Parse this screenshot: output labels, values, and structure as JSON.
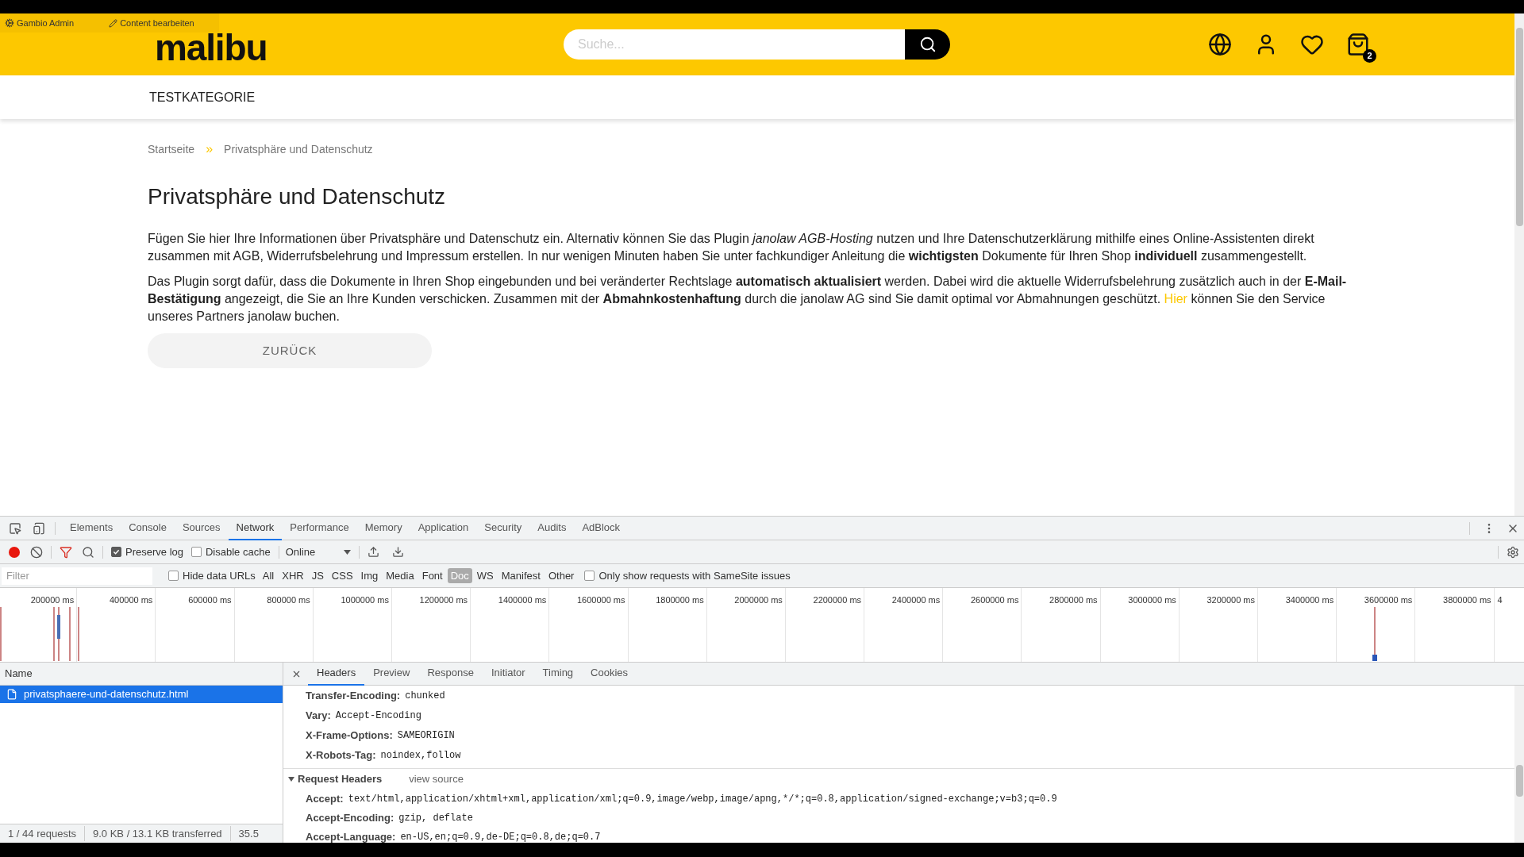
{
  "admin_bar": {
    "items": [
      "Gambio Admin",
      "Content bearbeiten"
    ]
  },
  "header": {
    "logo": "malibu",
    "search": {
      "placeholder": "Suche..."
    },
    "cart_count": "2"
  },
  "nav": {
    "items": [
      "TESTKATEGORIE"
    ]
  },
  "breadcrumb": {
    "items": [
      "Startseite",
      "Privatsphäre und Datenschutz"
    ],
    "separator": "»"
  },
  "content": {
    "title": "Privatsphäre und Datenschutz",
    "paragraph_1": "Fügen Sie hier Ihre Informationen über Privatsphäre und Datenschutz ein. Alternativ können Sie das Plugin *janolaw AGB-Hosting* nutzen und Ihre Datenschutzerklärung mithilfe eines Online-Assistenten direkt zusammen mit AGB, Widerrufsbelehrung und Impressum erstellen. In nur wenigen Minuten haben Sie unter fachkundiger Anleitung die **wichtigsten** Dokumente für Ihren Shop **individuell** zusammengestellt.",
    "paragraph_2": {
      "before": "Das Plugin sorgt dafür, dass die Dokumente in Ihren Shop eingebunden und bei veränderter Rechtslage **automatisch aktualisiert** werden. Dabei wird die aktuelle Widerrufsbelehrung zusätzlich auch in der **E-Mail-Bestätigung** angezeigt, die Sie an Ihre Kunden verschicken. Zusammen mit der **Abmahnkostenhaftung** durch die janolaw AG sind Sie damit optimal vor Abmahnungen geschützt.",
      "link": "Hier",
      "after": "können Sie den Service unseres Partners janolaw buchen."
    },
    "back_button": "ZURÜCK"
  },
  "devtools": {
    "tabs": [
      {
        "label": "Elements",
        "selected": false
      },
      {
        "label": "Console",
        "selected": false
      },
      {
        "label": "Sources",
        "selected": false
      },
      {
        "label": "Network",
        "selected": true
      },
      {
        "label": "Performance",
        "selected": false
      },
      {
        "label": "Memory",
        "selected": false
      },
      {
        "label": "Application",
        "selected": false
      },
      {
        "label": "Security",
        "selected": false
      },
      {
        "label": "Audits",
        "selected": false
      },
      {
        "label": "AdBlock",
        "selected": false
      }
    ],
    "toolbar": {
      "recording": true,
      "preserve_log": {
        "label": "Preserve log",
        "checked": true
      },
      "disable_cache": {
        "label": "Disable cache",
        "checked": false
      },
      "throttling": "Online"
    },
    "filter": {
      "placeholder": "Filter",
      "hide_data_urls": {
        "label": "Hide data URLs",
        "checked": false
      },
      "types": [
        {
          "label": "All",
          "selected": false
        },
        {
          "label": "XHR",
          "selected": false
        },
        {
          "label": "JS",
          "selected": false
        },
        {
          "label": "CSS",
          "selected": false
        },
        {
          "label": "Img",
          "selected": false
        },
        {
          "label": "Media",
          "selected": false
        },
        {
          "label": "Font",
          "selected": false
        },
        {
          "label": "Doc",
          "selected": true
        },
        {
          "label": "WS",
          "selected": false
        },
        {
          "label": "Manifest",
          "selected": false
        },
        {
          "label": "Other",
          "selected": false
        }
      ],
      "samesite": {
        "label": "Only show requests with SameSite issues",
        "checked": false
      }
    },
    "timeline": {
      "ticks": [
        "200000 ms",
        "400000 ms",
        "600000 ms",
        "800000 ms",
        "1000000 ms",
        "1200000 ms",
        "1400000 ms",
        "1600000 ms",
        "1800000 ms",
        "2000000 ms",
        "2200000 ms",
        "2400000 ms",
        "2600000 ms",
        "2800000 ms",
        "3000000 ms",
        "3200000 ms",
        "3400000 ms",
        "3600000 ms",
        "3800000 ms",
        "4"
      ]
    },
    "requests": {
      "column": "Name",
      "rows": [
        {
          "name": "privatsphaere-und-datenschutz.html",
          "selected": true
        }
      ]
    },
    "detail": {
      "tabs": [
        {
          "label": "Headers",
          "selected": true
        },
        {
          "label": "Preview",
          "selected": false
        },
        {
          "label": "Response",
          "selected": false
        },
        {
          "label": "Initiator",
          "selected": false
        },
        {
          "label": "Timing",
          "selected": false
        },
        {
          "label": "Cookies",
          "selected": false
        }
      ],
      "response_headers": [
        {
          "name": "Transfer-Encoding:",
          "value": "chunked"
        },
        {
          "name": "Vary:",
          "value": "Accept-Encoding"
        },
        {
          "name": "X-Frame-Options:",
          "value": "SAMEORIGIN"
        },
        {
          "name": "X-Robots-Tag:",
          "value": "noindex,follow"
        }
      ],
      "request_headers": {
        "title": "Request Headers",
        "expanded": true,
        "view_source": "view source",
        "items": [
          {
            "name": "Accept:",
            "value": "text/html,application/xhtml+xml,application/xml;q=0.9,image/webp,image/apng,*/*;q=0.8,application/signed-exchange;v=b3;q=0.9"
          },
          {
            "name": "Accept-Encoding:",
            "value": "gzip, deflate"
          },
          {
            "name": "Accept-Language:",
            "value": "en-US,en;q=0.9,de-DE;q=0.8,de;q=0.7"
          }
        ]
      }
    },
    "status": [
      "1 / 44 requests",
      "9.0 KB / 13.1 KB transferred",
      "35.5"
    ]
  }
}
